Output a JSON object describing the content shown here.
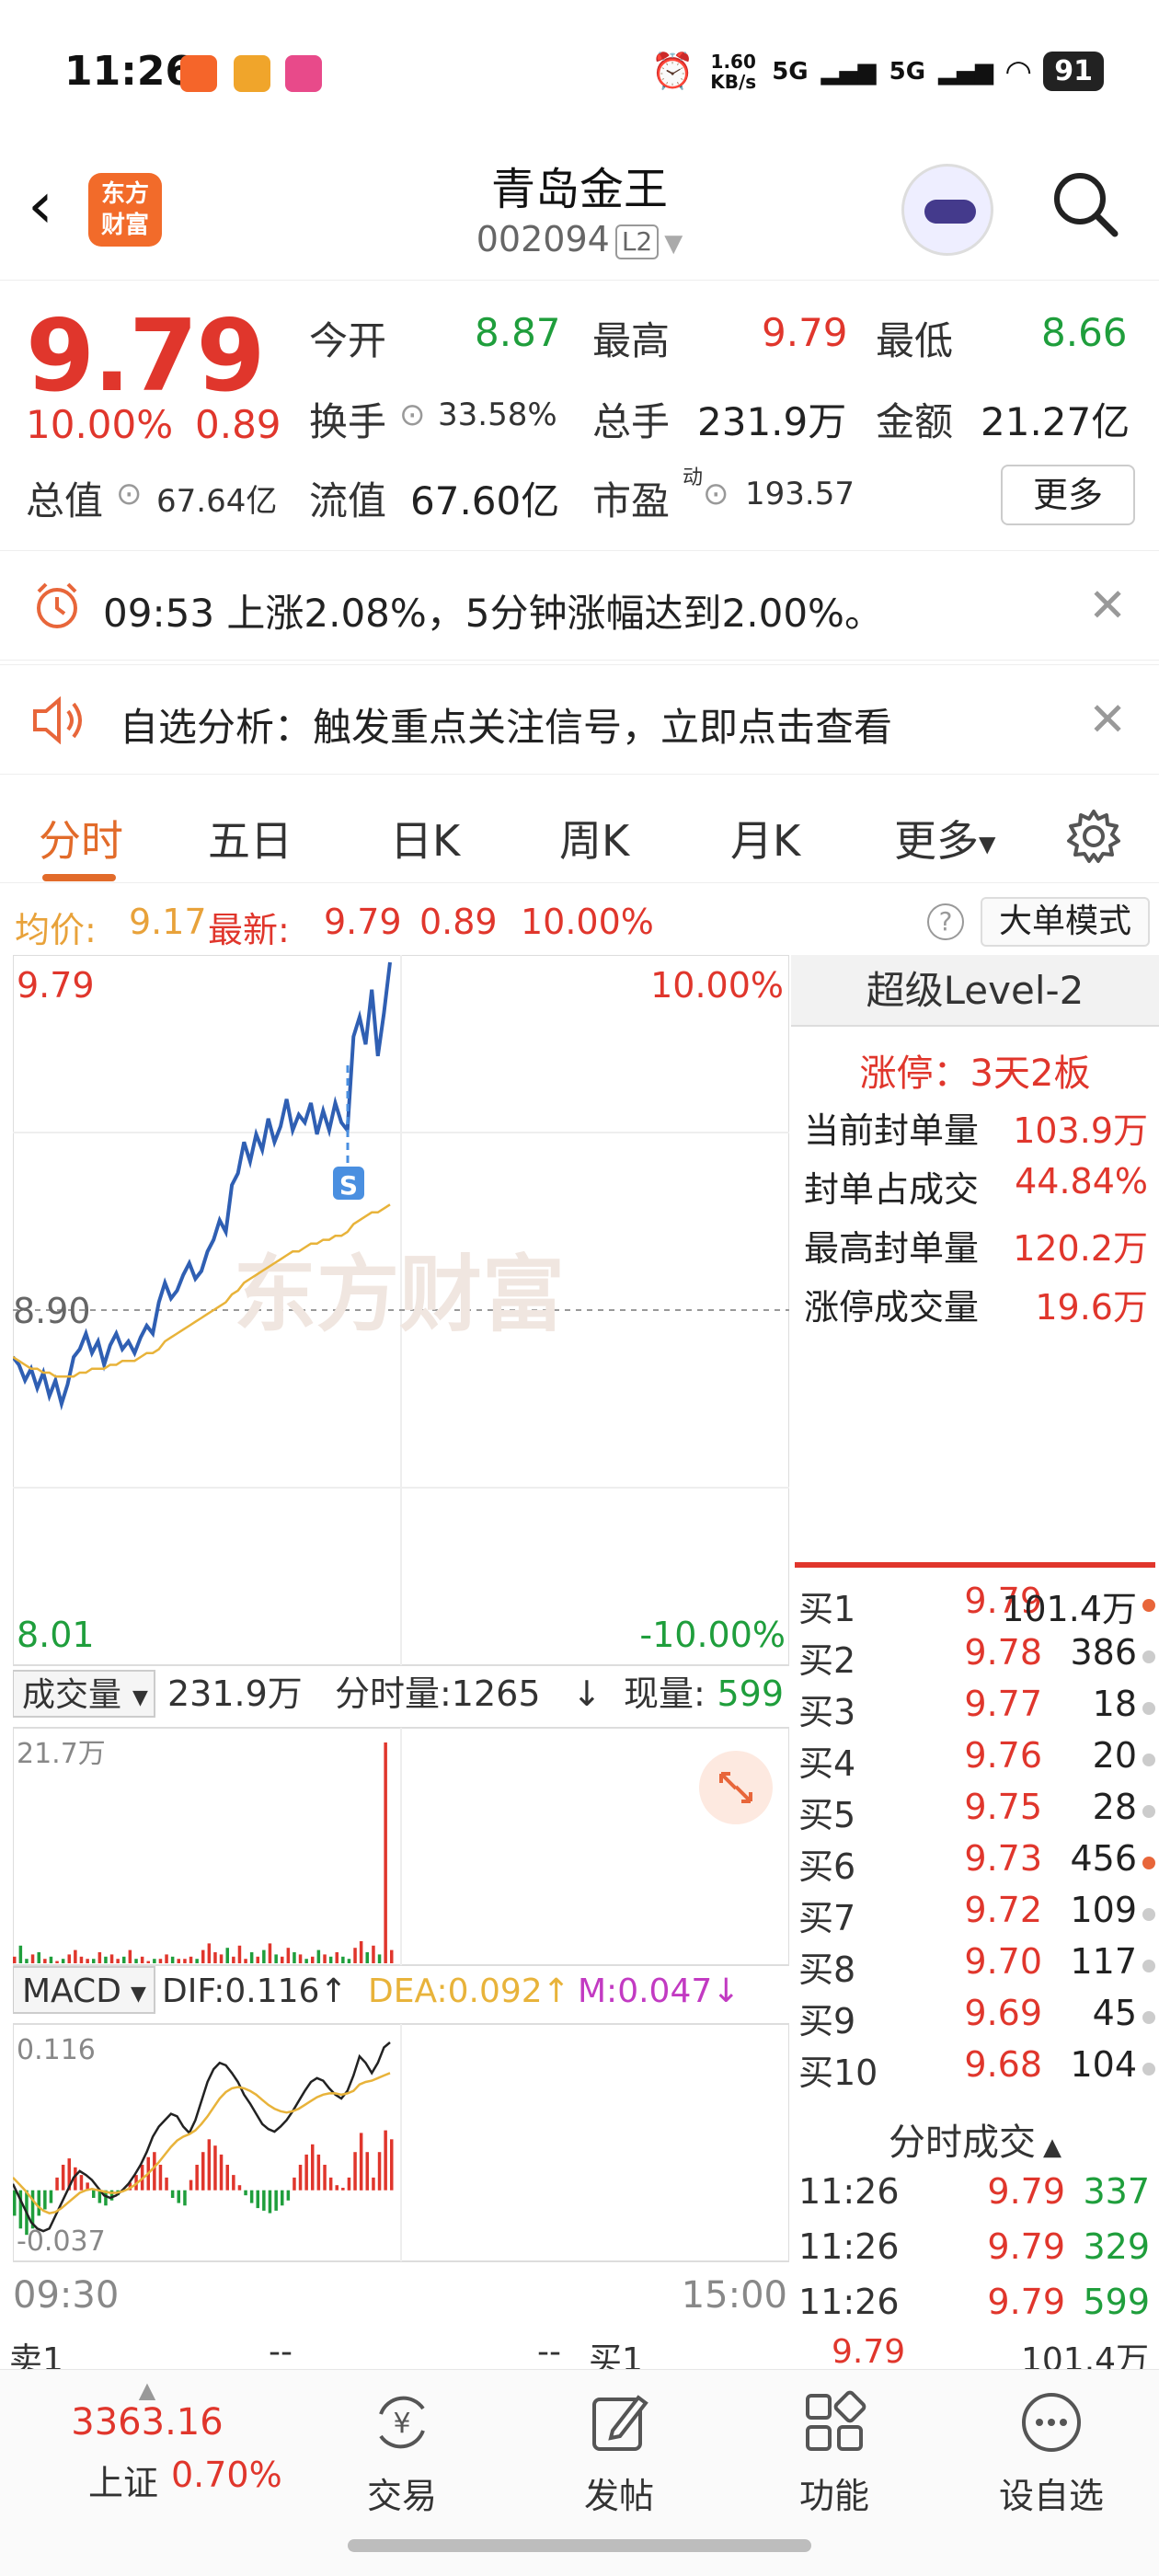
{
  "status_bar": {
    "time": "11:26",
    "speed": "1.60 KB/s",
    "signal1": "5G",
    "signal2": "5G",
    "battery": "91"
  },
  "header": {
    "logo_line1": "东方",
    "logo_line2": "财富",
    "title": "青岛金王",
    "code": "002094",
    "level_badge": "L2"
  },
  "quote": {
    "price": "9.79",
    "change_pct": "10.00%",
    "change_amt": "0.89",
    "open_label": "今开",
    "open": "8.87",
    "high_label": "最高",
    "high": "9.79",
    "low_label": "最低",
    "low": "8.66",
    "turnover_label": "换手",
    "turnover": "33.58%",
    "volume_label": "总手",
    "volume": "231.9万",
    "amount_label": "金额",
    "amount": "21.27亿",
    "mktcap_label": "总值",
    "mktcap": "67.64亿",
    "float_label": "流值",
    "float_cap": "67.60亿",
    "pe_label": "市盈",
    "pe_super": "动",
    "pe": "193.57",
    "more_label": "更多"
  },
  "alerts": [
    {
      "text": "09:53 上涨2.08%，5分钟涨幅达到2.00%。"
    },
    {
      "text": "自选分析：触发重点关注信号，立即点击查看"
    }
  ],
  "tabs": [
    "分时",
    "五日",
    "日K",
    "周K",
    "月K",
    "更多"
  ],
  "info_bar": {
    "avg_label": "均价:",
    "avg": "9.17",
    "latest_label": "最新:",
    "latest": "9.79",
    "chg": "0.89",
    "pct": "10.00%",
    "big_mode": "大单模式"
  },
  "chart_data": {
    "type": "line",
    "price_axis": {
      "top": "9.79",
      "mid": "8.90",
      "bottom": "8.01",
      "top_pct": "10.00%",
      "bottom_pct": "-10.00%"
    },
    "x_labels": [
      "09:30",
      "15:00"
    ],
    "watermark": "东方财富",
    "series": [
      {
        "name": "price",
        "color": "#2f5fb3",
        "values": [
          8.78,
          8.76,
          8.72,
          8.75,
          8.7,
          8.74,
          8.68,
          8.72,
          8.66,
          8.71,
          8.78,
          8.8,
          8.84,
          8.79,
          8.82,
          8.76,
          8.81,
          8.84,
          8.8,
          8.82,
          8.79,
          8.83,
          8.86,
          8.84,
          8.92,
          8.97,
          8.93,
          8.95,
          8.99,
          9.02,
          8.98,
          9.0,
          9.05,
          9.08,
          9.13,
          9.1,
          9.22,
          9.25,
          9.33,
          9.28,
          9.35,
          9.31,
          9.39,
          9.33,
          9.37,
          9.44,
          9.36,
          9.4,
          9.38,
          9.43,
          9.35,
          9.41,
          9.36,
          9.43,
          9.38,
          9.36,
          9.6,
          9.65,
          9.58,
          9.72,
          9.55,
          9.66,
          9.79
        ]
      },
      {
        "name": "avg",
        "color": "#e8b33a",
        "values": [
          8.78,
          8.77,
          8.76,
          8.75,
          8.75,
          8.74,
          8.74,
          8.73,
          8.73,
          8.73,
          8.73,
          8.74,
          8.74,
          8.75,
          8.75,
          8.75,
          8.76,
          8.76,
          8.77,
          8.77,
          8.77,
          8.78,
          8.79,
          8.79,
          8.8,
          8.82,
          8.83,
          8.84,
          8.85,
          8.86,
          8.87,
          8.88,
          8.89,
          8.9,
          8.91,
          8.92,
          8.94,
          8.95,
          8.97,
          8.98,
          8.99,
          9.0,
          9.01,
          9.02,
          9.03,
          9.04,
          9.05,
          9.05,
          9.06,
          9.07,
          9.07,
          9.08,
          9.08,
          9.09,
          9.09,
          9.1,
          9.12,
          9.13,
          9.14,
          9.15,
          9.15,
          9.16,
          9.17
        ]
      }
    ],
    "volume_header": {
      "label": "成交量",
      "total": "231.9万",
      "tick_label": "分时量:1265",
      "now_label": "现量:",
      "now": "599"
    },
    "volume_max_label": "21.7万",
    "volume_values": [
      3,
      8,
      2,
      4,
      5,
      2,
      3,
      1,
      2,
      4,
      6,
      3,
      2,
      2,
      5,
      3,
      4,
      2,
      3,
      6,
      2,
      3,
      1,
      2,
      2,
      4,
      3,
      2,
      2,
      3,
      2,
      6,
      9,
      5,
      4,
      7,
      3,
      8,
      2,
      5,
      3,
      6,
      9,
      4,
      3,
      7,
      5,
      4,
      2,
      3,
      6,
      4,
      3,
      5,
      3,
      2,
      7,
      10,
      5,
      8,
      4,
      100,
      6
    ],
    "macd_header": {
      "label": "MACD",
      "dif": "DIF:0.116↑",
      "dea": "DEA:0.092↑",
      "m": "M:0.047↓"
    },
    "macd_axis": {
      "top": "0.116",
      "bottom": "-0.037"
    },
    "macd_bars": [
      -0.02,
      -0.03,
      -0.035,
      -0.03,
      -0.02,
      -0.015,
      -0.01,
      0.01,
      0.02,
      0.025,
      0.018,
      0.012,
      0.006,
      -0.006,
      -0.01,
      -0.012,
      -0.008,
      -0.004,
      0.0,
      0.006,
      0.012,
      0.02,
      0.026,
      0.03,
      0.02,
      0.01,
      -0.006,
      -0.01,
      -0.012,
      0.008,
      0.02,
      0.03,
      0.04,
      0.035,
      0.028,
      0.02,
      0.012,
      0.004,
      -0.004,
      -0.01,
      -0.014,
      -0.016,
      -0.018,
      -0.016,
      -0.012,
      -0.008,
      0.01,
      0.02,
      0.028,
      0.036,
      0.028,
      0.02,
      0.01,
      0.004,
      0.002,
      0.01,
      0.03,
      0.045,
      0.03,
      0.01,
      0.03,
      0.047,
      0.04
    ],
    "macd_dif": [
      0.005,
      -0.005,
      -0.015,
      -0.025,
      -0.03,
      -0.032,
      -0.03,
      -0.02,
      -0.01,
      0.0,
      0.01,
      0.015,
      0.012,
      0.008,
      0.002,
      -0.004,
      -0.006,
      -0.004,
      0.0,
      0.005,
      0.012,
      0.02,
      0.03,
      0.042,
      0.05,
      0.055,
      0.06,
      0.058,
      0.05,
      0.045,
      0.055,
      0.07,
      0.085,
      0.095,
      0.1,
      0.098,
      0.092,
      0.085,
      0.075,
      0.068,
      0.06,
      0.052,
      0.048,
      0.046,
      0.05,
      0.055,
      0.062,
      0.07,
      0.078,
      0.085,
      0.088,
      0.086,
      0.08,
      0.075,
      0.072,
      0.078,
      0.09,
      0.105,
      0.1,
      0.092,
      0.1,
      0.112,
      0.116
    ],
    "macd_dea": [
      0.01,
      0.005,
      0.0,
      -0.006,
      -0.012,
      -0.016,
      -0.018,
      -0.017,
      -0.014,
      -0.01,
      -0.006,
      -0.002,
      0.0,
      0.001,
      0.0,
      -0.001,
      -0.002,
      -0.002,
      -0.001,
      0.001,
      0.004,
      0.008,
      0.012,
      0.017,
      0.022,
      0.028,
      0.034,
      0.039,
      0.042,
      0.044,
      0.047,
      0.052,
      0.058,
      0.065,
      0.072,
      0.077,
      0.08,
      0.081,
      0.08,
      0.078,
      0.075,
      0.071,
      0.067,
      0.064,
      0.062,
      0.061,
      0.062,
      0.064,
      0.067,
      0.07,
      0.073,
      0.075,
      0.076,
      0.076,
      0.075,
      0.076,
      0.078,
      0.083,
      0.085,
      0.086,
      0.088,
      0.09,
      0.092
    ]
  },
  "level2": {
    "title": "超级Level-2",
    "limit_up_label": "涨停：",
    "limit_up": "3天2板",
    "rows": [
      {
        "label": "当前封单量",
        "value": "103.9万"
      },
      {
        "label": "封单占成交",
        "value": "44.84%"
      },
      {
        "label": "最高封单量",
        "value": "120.2万"
      },
      {
        "label": "涨停成交量",
        "value": "19.6万"
      }
    ]
  },
  "bids": [
    {
      "name": "买1",
      "price": "9.79",
      "qty": "101.4万",
      "mark": true
    },
    {
      "name": "买2",
      "price": "9.78",
      "qty": "386",
      "mark": false
    },
    {
      "name": "买3",
      "price": "9.77",
      "qty": "18",
      "mark": false
    },
    {
      "name": "买4",
      "price": "9.76",
      "qty": "20",
      "mark": false
    },
    {
      "name": "买5",
      "price": "9.75",
      "qty": "28",
      "mark": false
    },
    {
      "name": "买6",
      "price": "9.73",
      "qty": "456",
      "mark": true
    },
    {
      "name": "买7",
      "price": "9.72",
      "qty": "109",
      "mark": false
    },
    {
      "name": "买8",
      "price": "9.70",
      "qty": "117",
      "mark": false
    },
    {
      "name": "买9",
      "price": "9.69",
      "qty": "45",
      "mark": false
    },
    {
      "name": "买10",
      "price": "9.68",
      "qty": "104",
      "mark": false
    }
  ],
  "ticks_title": "分时成交",
  "ticks": [
    {
      "time": "11:26",
      "price": "9.79",
      "qty": "337"
    },
    {
      "time": "11:26",
      "price": "9.79",
      "qty": "329"
    },
    {
      "time": "11:26",
      "price": "9.79",
      "qty": "599"
    }
  ],
  "strip": {
    "sell1": "卖1",
    "sell1_price": "--",
    "sell1_qty": "--",
    "buy1": "买1",
    "buy1_price": "9.79",
    "buy1_qty": "101.4万"
  },
  "bottom_bar": {
    "index_value": "3363.16",
    "index_name": "上证",
    "index_pct": "0.70%",
    "items": [
      "交易",
      "发帖",
      "功能",
      "设自选"
    ]
  },
  "colors": {
    "up": "#e0362c",
    "down": "#1f9e3c",
    "accent": "#e26b2a",
    "price_line": "#2f5fb3",
    "avg_line": "#e8b33a"
  }
}
